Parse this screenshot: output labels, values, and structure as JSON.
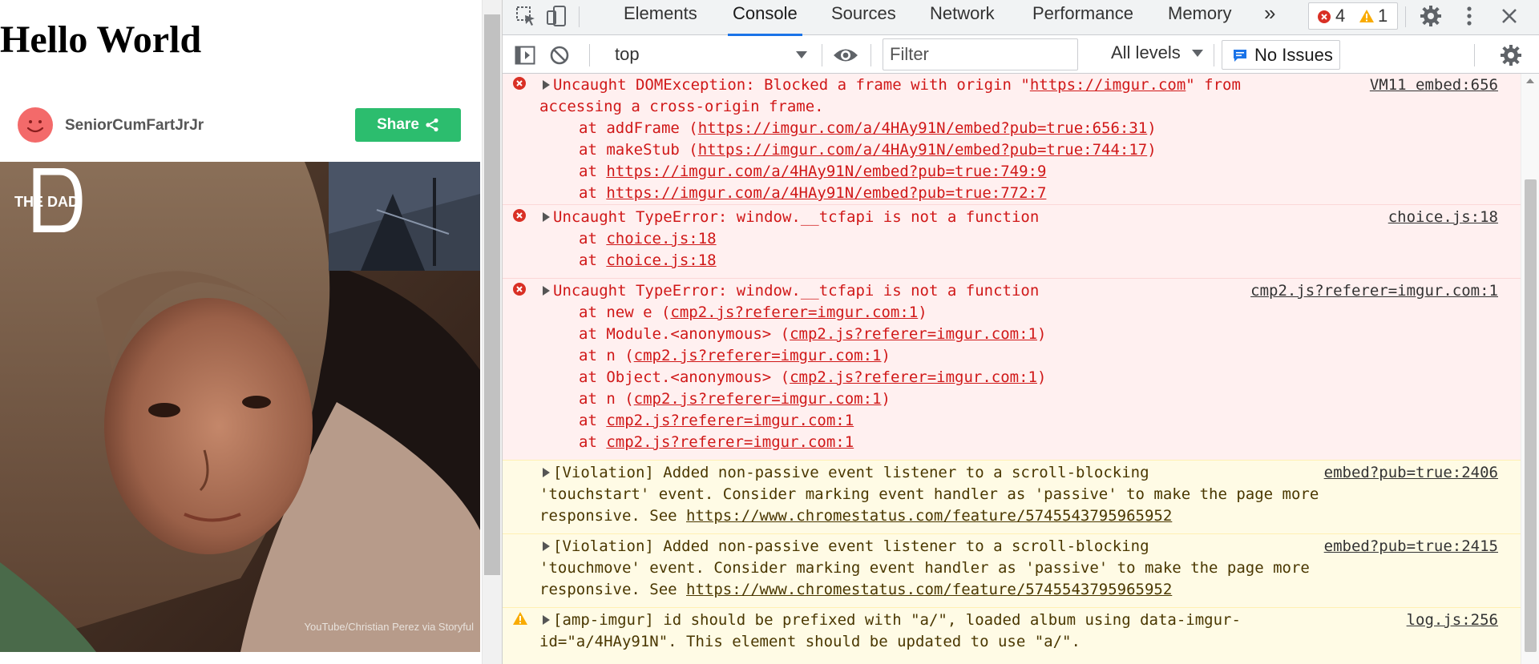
{
  "page": {
    "title": "Hello World",
    "username": "SeniorCumFartJrJr",
    "share_label": "Share",
    "brand_logo_text": "THE DAD",
    "video_credit": "YouTube/Christian Perez via Storyful"
  },
  "devtools": {
    "tabs": [
      {
        "label": "Elements"
      },
      {
        "label": "Console",
        "active": true
      },
      {
        "label": "Sources"
      },
      {
        "label": "Network"
      },
      {
        "label": "Performance"
      },
      {
        "label": "Memory"
      }
    ],
    "more_tabs_glyph": "»",
    "error_count": "4",
    "warning_count": "1",
    "context": "top",
    "filter_placeholder": "Filter",
    "levels_label": "All levels",
    "issues_label": "No Issues"
  },
  "colors": {
    "accent": "#1a73e8",
    "error_text": "#d01818",
    "error_bg": "#fff0f0",
    "warning_bg": "#fffbe5",
    "share_green": "#2cbd6e",
    "avatar_red": "#f36a6a"
  },
  "console": {
    "m1": {
      "l1": "Uncaught DOMException: Blocked a frame with origin \"",
      "l1_link": "https://imgur.com",
      "l1_end": "\" from",
      "l2": "accessing a cross-origin frame.",
      "s1_pre": "at addFrame (",
      "s1_link": "https://imgur.com/a/4HAy91N/embed?pub=true:656:31",
      "s2_pre": "at makeStub (",
      "s2_link": "https://imgur.com/a/4HAy91N/embed?pub=true:744:17",
      "s3_pre": "at ",
      "s3_link": "https://imgur.com/a/4HAy91N/embed?pub=true:749:9",
      "s4_pre": "at ",
      "s4_link": "https://imgur.com/a/4HAy91N/embed?pub=true:772:7",
      "src": "VM11 embed:656"
    },
    "m2": {
      "l1": "Uncaught TypeError: window.__tcfapi is not a function",
      "s1_pre": "at ",
      "s1_link": "choice.js:18",
      "s2_pre": "at ",
      "s2_link": "choice.js:18",
      "src": "choice.js:18"
    },
    "m3": {
      "l1": "Uncaught TypeError: window.__tcfapi is not a function",
      "s1_pre": "at new e (",
      "s1_link": "cmp2.js?referer=imgur.com:1",
      "s2_pre": "at Module.<anonymous> (",
      "s2_link": "cmp2.js?referer=imgur.com:1",
      "s3_pre": "at n (",
      "s3_link": "cmp2.js?referer=imgur.com:1",
      "s4_pre": "at Object.<anonymous> (",
      "s4_link": "cmp2.js?referer=imgur.com:1",
      "s5_pre": "at n (",
      "s5_link": "cmp2.js?referer=imgur.com:1",
      "s6_pre": "at ",
      "s6_link": "cmp2.js?referer=imgur.com:1",
      "s7_pre": "at ",
      "s7_link": "cmp2.js?referer=imgur.com:1",
      "close": ")",
      "src": "cmp2.js?referer=imgur.com:1"
    },
    "m4": {
      "l1": "[Violation] Added non-passive event listener to a scroll-blocking",
      "l2": "'touchstart' event. Consider marking event handler as 'passive' to make the page more",
      "l3_pre": "responsive. See ",
      "l3_link": "https://www.chromestatus.com/feature/5745543795965952",
      "src": "embed?pub=true:2406"
    },
    "m5": {
      "l1": "[Violation] Added non-passive event listener to a scroll-blocking",
      "l2": "'touchmove' event. Consider marking event handler as 'passive' to make the page more",
      "l3_pre": "responsive. See ",
      "l3_link": "https://www.chromestatus.com/feature/5745543795965952",
      "src": "embed?pub=true:2415"
    },
    "m6": {
      "l1": "[amp-imgur] id should be prefixed with \"a/\", loaded album using data-imgur-",
      "l2": "id=\"a/4HAy91N\". This element should be updated to use \"a/\".",
      "src": "log.js:256"
    }
  }
}
